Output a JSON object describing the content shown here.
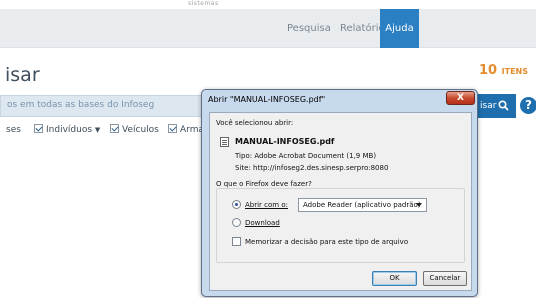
{
  "topstrip": {
    "text": "sistemas"
  },
  "nav": {
    "items": [
      {
        "label": "Pesquisa"
      },
      {
        "label": "Relatório"
      },
      {
        "label": "Ajuda",
        "active": true
      }
    ]
  },
  "page": {
    "title": "isar",
    "items_count": "10",
    "items_unit": "ITENS"
  },
  "search": {
    "placeholder": "os em todas as bases do Infoseg",
    "button_label": "isar",
    "help_label": "?"
  },
  "filters": [
    {
      "label": "ses",
      "checked": false
    },
    {
      "label": "Indivíduos",
      "checked": true,
      "dropdown": true
    },
    {
      "label": "Veículos",
      "checked": true
    },
    {
      "label": "Armas",
      "checked": true
    }
  ],
  "dialog": {
    "title": "Abrir \"MANUAL-INFOSEG.pdf\"",
    "close_label": "X",
    "intro": "Você selecionou abrir:",
    "file_name": "MANUAL-INFOSEG.pdf",
    "type_line": "Tipo:  Adobe Acrobat Document (1,9 MB)",
    "site_line": "Site:  http://infoseg2.des.sinesp.serpro:8080",
    "question": "O que o Firefox deve fazer?",
    "option_open": "Abrir com o:",
    "open_with_value": "Adobe Reader  (aplicativo padrão)",
    "option_download": "Download",
    "remember_label": "Memorizar a decisão para este tipo de arquivo",
    "ok_label": "OK",
    "cancel_label": "Cancelar"
  },
  "colors": {
    "accent": "#2b7fc3",
    "items_count": "#e38b2e",
    "search_bg": "#dde7f0",
    "dialog_frame": "#c7d9ec"
  }
}
